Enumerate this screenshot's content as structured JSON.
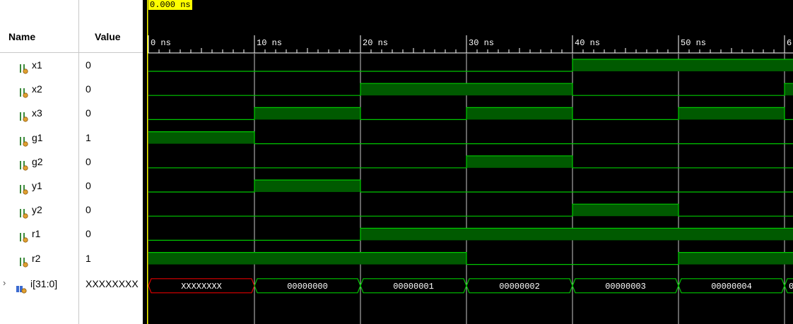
{
  "header": {
    "name_label": "Name",
    "value_label": "Value"
  },
  "cursor": {
    "time_label": "0.000 ns"
  },
  "timeline": {
    "ticks": [
      "0 ns",
      "10 ns",
      "20 ns",
      "30 ns",
      "40 ns",
      "50 ns",
      "6"
    ],
    "grid_step_ns": 10
  },
  "signals": [
    {
      "name": "x1",
      "value": "0",
      "type": "bit",
      "levels": [
        0,
        0,
        0,
        0,
        1,
        1,
        1
      ]
    },
    {
      "name": "x2",
      "value": "0",
      "type": "bit",
      "levels": [
        0,
        0,
        1,
        1,
        0,
        0,
        1
      ]
    },
    {
      "name": "x3",
      "value": "0",
      "type": "bit",
      "levels": [
        0,
        1,
        0,
        1,
        0,
        1,
        0
      ]
    },
    {
      "name": "g1",
      "value": "1",
      "type": "bit",
      "levels": [
        1,
        0,
        0,
        0,
        0,
        0,
        0
      ]
    },
    {
      "name": "g2",
      "value": "0",
      "type": "bit",
      "levels": [
        0,
        0,
        0,
        1,
        0,
        0,
        0
      ]
    },
    {
      "name": "y1",
      "value": "0",
      "type": "bit",
      "levels": [
        0,
        1,
        0,
        0,
        0,
        0,
        0
      ]
    },
    {
      "name": "y2",
      "value": "0",
      "type": "bit",
      "levels": [
        0,
        0,
        0,
        0,
        1,
        0,
        0
      ]
    },
    {
      "name": "r1",
      "value": "0",
      "type": "bit",
      "levels": [
        0,
        0,
        1,
        1,
        1,
        1,
        1
      ]
    },
    {
      "name": "r2",
      "value": "1",
      "type": "bit",
      "levels": [
        1,
        1,
        1,
        0,
        0,
        1,
        1
      ]
    }
  ],
  "bus": {
    "name": "i[31:0]",
    "value": "XXXXXXXX",
    "segments": [
      "XXXXXXXX",
      "00000000",
      "00000001",
      "00000002",
      "00000003",
      "00000004",
      "0"
    ]
  },
  "colors": {
    "wave_green": "#00c800",
    "fill_green": "#005a00",
    "undefined_red": "#e00000",
    "cursor_yellow": "#ffff00"
  }
}
